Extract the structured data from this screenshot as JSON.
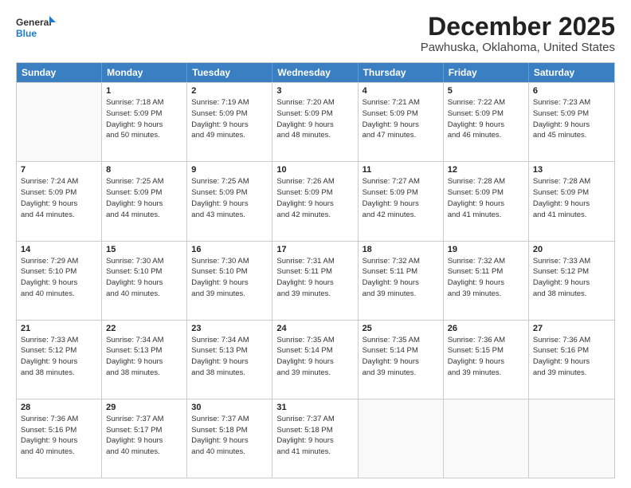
{
  "header": {
    "logo_line1": "General",
    "logo_line2": "Blue",
    "title": "December 2025",
    "subtitle": "Pawhuska, Oklahoma, United States"
  },
  "days_of_week": [
    "Sunday",
    "Monday",
    "Tuesday",
    "Wednesday",
    "Thursday",
    "Friday",
    "Saturday"
  ],
  "weeks": [
    [
      {
        "day": "",
        "info": ""
      },
      {
        "day": "1",
        "info": "Sunrise: 7:18 AM\nSunset: 5:09 PM\nDaylight: 9 hours\nand 50 minutes."
      },
      {
        "day": "2",
        "info": "Sunrise: 7:19 AM\nSunset: 5:09 PM\nDaylight: 9 hours\nand 49 minutes."
      },
      {
        "day": "3",
        "info": "Sunrise: 7:20 AM\nSunset: 5:09 PM\nDaylight: 9 hours\nand 48 minutes."
      },
      {
        "day": "4",
        "info": "Sunrise: 7:21 AM\nSunset: 5:09 PM\nDaylight: 9 hours\nand 47 minutes."
      },
      {
        "day": "5",
        "info": "Sunrise: 7:22 AM\nSunset: 5:09 PM\nDaylight: 9 hours\nand 46 minutes."
      },
      {
        "day": "6",
        "info": "Sunrise: 7:23 AM\nSunset: 5:09 PM\nDaylight: 9 hours\nand 45 minutes."
      }
    ],
    [
      {
        "day": "7",
        "info": "Sunrise: 7:24 AM\nSunset: 5:09 PM\nDaylight: 9 hours\nand 44 minutes."
      },
      {
        "day": "8",
        "info": "Sunrise: 7:25 AM\nSunset: 5:09 PM\nDaylight: 9 hours\nand 44 minutes."
      },
      {
        "day": "9",
        "info": "Sunrise: 7:25 AM\nSunset: 5:09 PM\nDaylight: 9 hours\nand 43 minutes."
      },
      {
        "day": "10",
        "info": "Sunrise: 7:26 AM\nSunset: 5:09 PM\nDaylight: 9 hours\nand 42 minutes."
      },
      {
        "day": "11",
        "info": "Sunrise: 7:27 AM\nSunset: 5:09 PM\nDaylight: 9 hours\nand 42 minutes."
      },
      {
        "day": "12",
        "info": "Sunrise: 7:28 AM\nSunset: 5:09 PM\nDaylight: 9 hours\nand 41 minutes."
      },
      {
        "day": "13",
        "info": "Sunrise: 7:28 AM\nSunset: 5:09 PM\nDaylight: 9 hours\nand 41 minutes."
      }
    ],
    [
      {
        "day": "14",
        "info": "Sunrise: 7:29 AM\nSunset: 5:10 PM\nDaylight: 9 hours\nand 40 minutes."
      },
      {
        "day": "15",
        "info": "Sunrise: 7:30 AM\nSunset: 5:10 PM\nDaylight: 9 hours\nand 40 minutes."
      },
      {
        "day": "16",
        "info": "Sunrise: 7:30 AM\nSunset: 5:10 PM\nDaylight: 9 hours\nand 39 minutes."
      },
      {
        "day": "17",
        "info": "Sunrise: 7:31 AM\nSunset: 5:11 PM\nDaylight: 9 hours\nand 39 minutes."
      },
      {
        "day": "18",
        "info": "Sunrise: 7:32 AM\nSunset: 5:11 PM\nDaylight: 9 hours\nand 39 minutes."
      },
      {
        "day": "19",
        "info": "Sunrise: 7:32 AM\nSunset: 5:11 PM\nDaylight: 9 hours\nand 39 minutes."
      },
      {
        "day": "20",
        "info": "Sunrise: 7:33 AM\nSunset: 5:12 PM\nDaylight: 9 hours\nand 38 minutes."
      }
    ],
    [
      {
        "day": "21",
        "info": "Sunrise: 7:33 AM\nSunset: 5:12 PM\nDaylight: 9 hours\nand 38 minutes."
      },
      {
        "day": "22",
        "info": "Sunrise: 7:34 AM\nSunset: 5:13 PM\nDaylight: 9 hours\nand 38 minutes."
      },
      {
        "day": "23",
        "info": "Sunrise: 7:34 AM\nSunset: 5:13 PM\nDaylight: 9 hours\nand 38 minutes."
      },
      {
        "day": "24",
        "info": "Sunrise: 7:35 AM\nSunset: 5:14 PM\nDaylight: 9 hours\nand 39 minutes."
      },
      {
        "day": "25",
        "info": "Sunrise: 7:35 AM\nSunset: 5:14 PM\nDaylight: 9 hours\nand 39 minutes."
      },
      {
        "day": "26",
        "info": "Sunrise: 7:36 AM\nSunset: 5:15 PM\nDaylight: 9 hours\nand 39 minutes."
      },
      {
        "day": "27",
        "info": "Sunrise: 7:36 AM\nSunset: 5:16 PM\nDaylight: 9 hours\nand 39 minutes."
      }
    ],
    [
      {
        "day": "28",
        "info": "Sunrise: 7:36 AM\nSunset: 5:16 PM\nDaylight: 9 hours\nand 40 minutes."
      },
      {
        "day": "29",
        "info": "Sunrise: 7:37 AM\nSunset: 5:17 PM\nDaylight: 9 hours\nand 40 minutes."
      },
      {
        "day": "30",
        "info": "Sunrise: 7:37 AM\nSunset: 5:18 PM\nDaylight: 9 hours\nand 40 minutes."
      },
      {
        "day": "31",
        "info": "Sunrise: 7:37 AM\nSunset: 5:18 PM\nDaylight: 9 hours\nand 41 minutes."
      },
      {
        "day": "",
        "info": ""
      },
      {
        "day": "",
        "info": ""
      },
      {
        "day": "",
        "info": ""
      }
    ]
  ]
}
